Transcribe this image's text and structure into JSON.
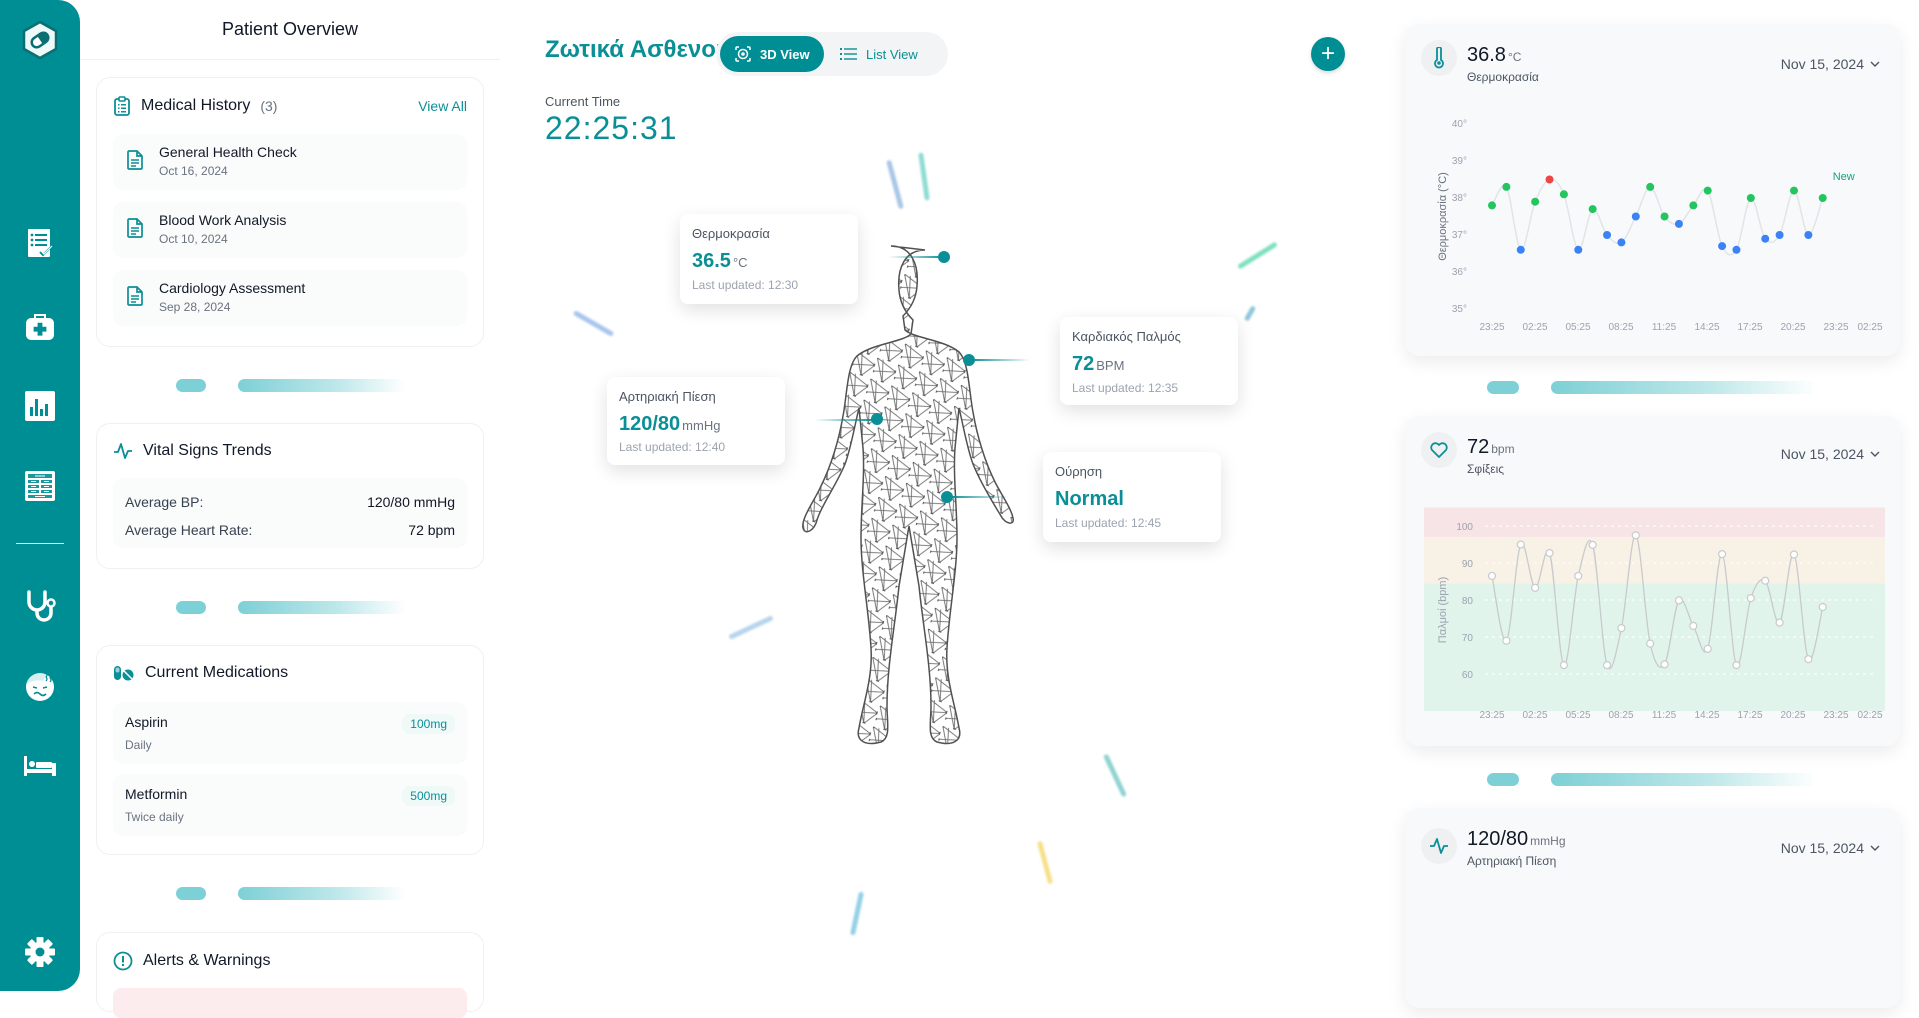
{
  "sidebar": {
    "items": [
      {
        "icon": "checklist-icon",
        "label": "Tasks"
      },
      {
        "icon": "medkit-icon",
        "label": "Medical Kit"
      },
      {
        "icon": "bar-chart-icon",
        "label": "Analytics"
      },
      {
        "icon": "table-icon",
        "label": "Records"
      },
      {
        "icon": "stethoscope-icon",
        "label": "Doctor"
      },
      {
        "icon": "sick-face-icon",
        "label": "Symptoms"
      },
      {
        "icon": "bed-icon",
        "label": "Beds"
      },
      {
        "icon": "gear-icon",
        "label": "Settings"
      }
    ]
  },
  "left_panel": {
    "title": "Patient Overview",
    "medical_history": {
      "title": "Medical History",
      "count": "(3)",
      "view_all": "View All",
      "items": [
        {
          "title": "General Health Check",
          "date": "Oct 16, 2024"
        },
        {
          "title": "Blood Work Analysis",
          "date": "Oct 10, 2024"
        },
        {
          "title": "Cardiology Assessment",
          "date": "Sep 28, 2024"
        }
      ]
    },
    "vital_trends": {
      "title": "Vital Signs Trends",
      "rows": [
        {
          "label": "Average BP:",
          "value": "120/80 mmHg"
        },
        {
          "label": "Average Heart Rate:",
          "value": "72 bpm"
        }
      ]
    },
    "medications": {
      "title": "Current Medications",
      "items": [
        {
          "name": "Aspirin",
          "frequency": "Daily",
          "dose": "100mg"
        },
        {
          "name": "Metformin",
          "frequency": "Twice daily",
          "dose": "500mg"
        }
      ]
    },
    "alerts": {
      "title": "Alerts & Warnings"
    }
  },
  "center": {
    "title": "Ζωτικά Ασθενούς",
    "view_3d": "3D View",
    "view_list": "List View",
    "current_time_label": "Current Time",
    "current_time": "22:25:31",
    "vitals": [
      {
        "label": "Θερμοκρασία",
        "value": "36.5",
        "unit": "°C",
        "updated": "Last updated: 12:30"
      },
      {
        "label": "Καρδιακός Παλμός",
        "value": "72",
        "unit": "BPM",
        "updated": "Last updated: 12:35"
      },
      {
        "label": "Αρτηριακή Πίεση",
        "value": "120/80",
        "unit": "mmHg",
        "updated": "Last updated: 12:40"
      },
      {
        "label": "Ούρηση",
        "value": "Normal",
        "unit": "",
        "updated": "Last updated: 12:45"
      }
    ]
  },
  "right_panel": {
    "temperature": {
      "value": "36.8",
      "unit": "°C",
      "label": "Θερμοκρασία",
      "date": "Nov 15, 2024"
    },
    "heart_rate": {
      "value": "72",
      "unit": "bpm",
      "label": "Σφίξεις",
      "date": "Nov 15, 2024"
    },
    "blood_pressure": {
      "value": "120/80",
      "unit": "mmHg",
      "label": "Αρτηριακή Πίεση",
      "date": "Nov 15, 2024"
    }
  },
  "colors": {
    "accent": "#008e95",
    "normal": "#22c55e",
    "low": "#3b82f6",
    "high": "#ef4444"
  },
  "chart_data": [
    {
      "type": "scatter",
      "title": "Θερμοκρασία",
      "ylabel": "Θερμοκρασία (°C)",
      "xlabel": "",
      "ylim": [
        35,
        40
      ],
      "yticks": [
        "35°",
        "36°",
        "37°",
        "38°",
        "39°",
        "40°"
      ],
      "yticks_values": [
        35,
        36,
        37,
        38,
        39,
        40
      ],
      "xticks": [
        "23:25",
        "02:25",
        "05:25",
        "08:25",
        "11:25",
        "14:25",
        "17:25",
        "20:25",
        "23:25",
        "02:25"
      ],
      "annotation": "New",
      "grid": false,
      "values": [
        37.8,
        38.3,
        36.6,
        37.9,
        38.5,
        38.1,
        36.6,
        37.7,
        37.0,
        36.8,
        37.5,
        38.3,
        37.5,
        37.3,
        37.8,
        38.2,
        36.7,
        36.6,
        38.0,
        36.9,
        37.0,
        38.2,
        37.0,
        38.0
      ],
      "point_status": [
        "normal",
        "normal",
        "low",
        "normal",
        "high",
        "normal",
        "low",
        "normal",
        "low",
        "low",
        "low",
        "normal",
        "normal",
        "low",
        "normal",
        "normal",
        "low",
        "low",
        "normal",
        "low",
        "low",
        "normal",
        "low",
        "normal"
      ]
    },
    {
      "type": "line",
      "title": "Σφίξεις",
      "ylabel": "Παλμοί (bpm)",
      "xlabel": "",
      "ylim": [
        50,
        105
      ],
      "yticks": [
        "60",
        "70",
        "80",
        "90",
        "100"
      ],
      "yticks_values": [
        60,
        70,
        80,
        90,
        100
      ],
      "xticks": [
        "23:25",
        "02:25",
        "05:25",
        "08:25",
        "11:25",
        "14:25",
        "17:25",
        "20:25",
        "23:25",
        "02:25"
      ],
      "bands": [
        {
          "name": "high",
          "from": 97,
          "to": 105,
          "color": "#f7e4e6"
        },
        {
          "name": "elevated",
          "from": 84.5,
          "to": 97,
          "color": "#f7f1e6"
        },
        {
          "name": "normal",
          "from": 50,
          "to": 84.5,
          "color": "#e0f4ec"
        }
      ],
      "grid": true,
      "values": [
        86.5,
        69.0,
        95.0,
        83.3,
        92.7,
        62.4,
        86.5,
        94.9,
        62.4,
        72.4,
        97.5,
        68.2,
        62.6,
        79.9,
        73.0,
        66.8,
        92.4,
        62.4,
        80.5,
        85.2,
        73.9,
        92.3,
        64.0,
        78.1
      ]
    }
  ]
}
